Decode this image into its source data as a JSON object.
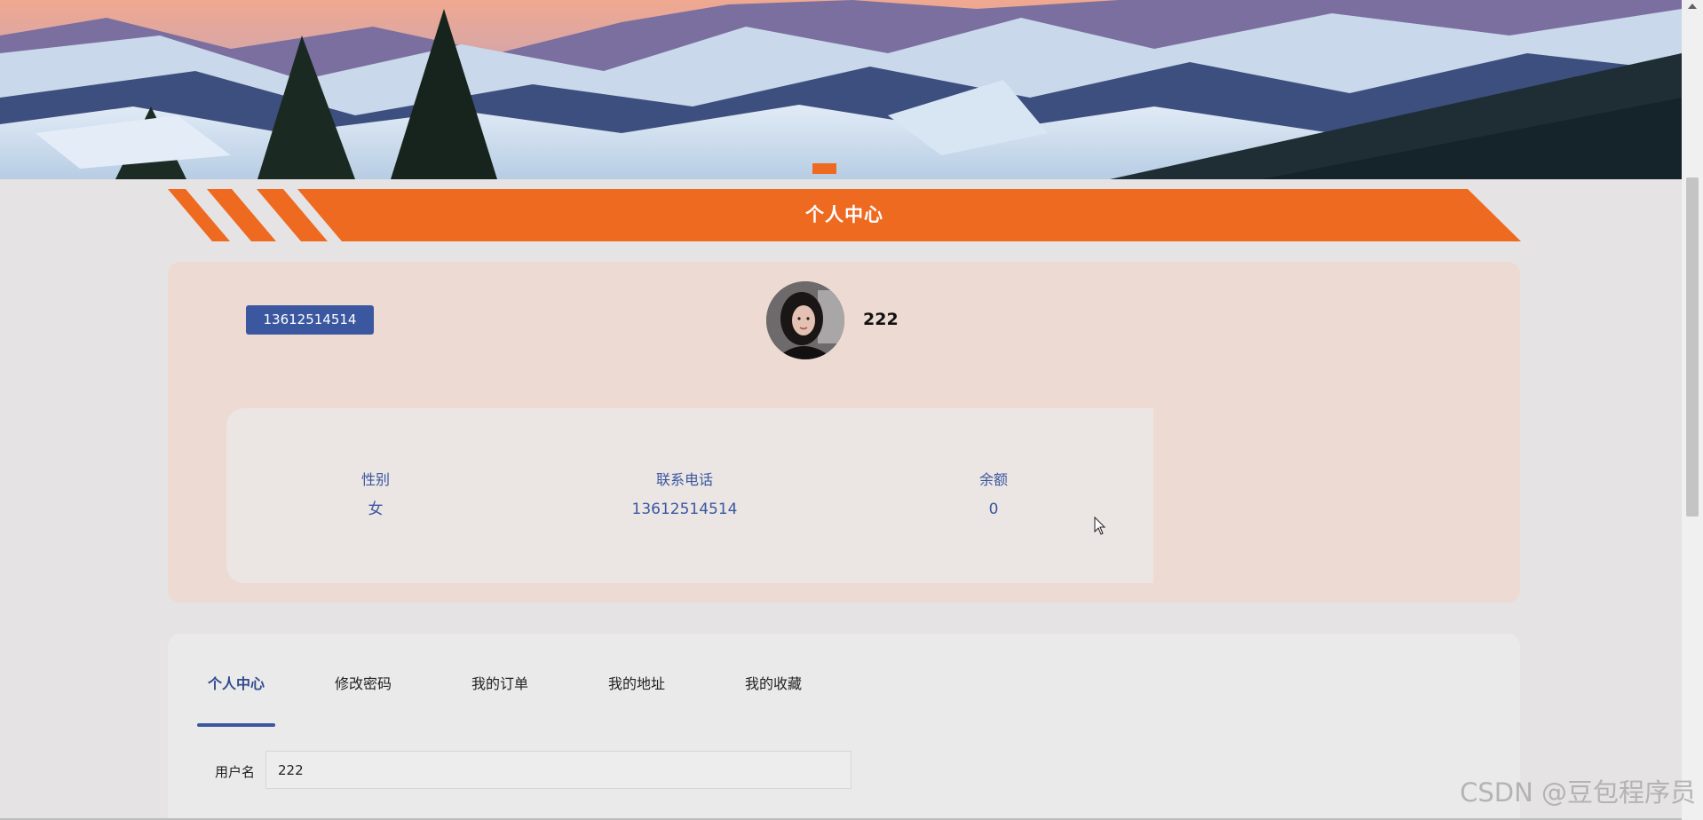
{
  "banner": {
    "image_icon": "snowy-mountain-landscape",
    "slides_visible": 1
  },
  "section_title": "个人中心",
  "profile": {
    "phone_badge": "13612514514",
    "username": "222",
    "avatar_icon": "user-avatar-photo",
    "info": [
      {
        "label": "性别",
        "value": "女"
      },
      {
        "label": "联系电话",
        "value": "13612514514"
      },
      {
        "label": "余额",
        "value": "0"
      }
    ]
  },
  "tabs": [
    {
      "label": "个人中心",
      "active": true
    },
    {
      "label": "修改密码",
      "active": false
    },
    {
      "label": "我的订单",
      "active": false
    },
    {
      "label": "我的地址",
      "active": false
    },
    {
      "label": "我的收藏",
      "active": false
    }
  ],
  "form": {
    "username_label": "用户名",
    "username_value": "222"
  },
  "watermark": "CSDN @豆包程序员",
  "colors": {
    "accent_orange": "#ee6a21",
    "primary_blue": "#3b57a0",
    "profile_bg": "#eddbd3"
  }
}
